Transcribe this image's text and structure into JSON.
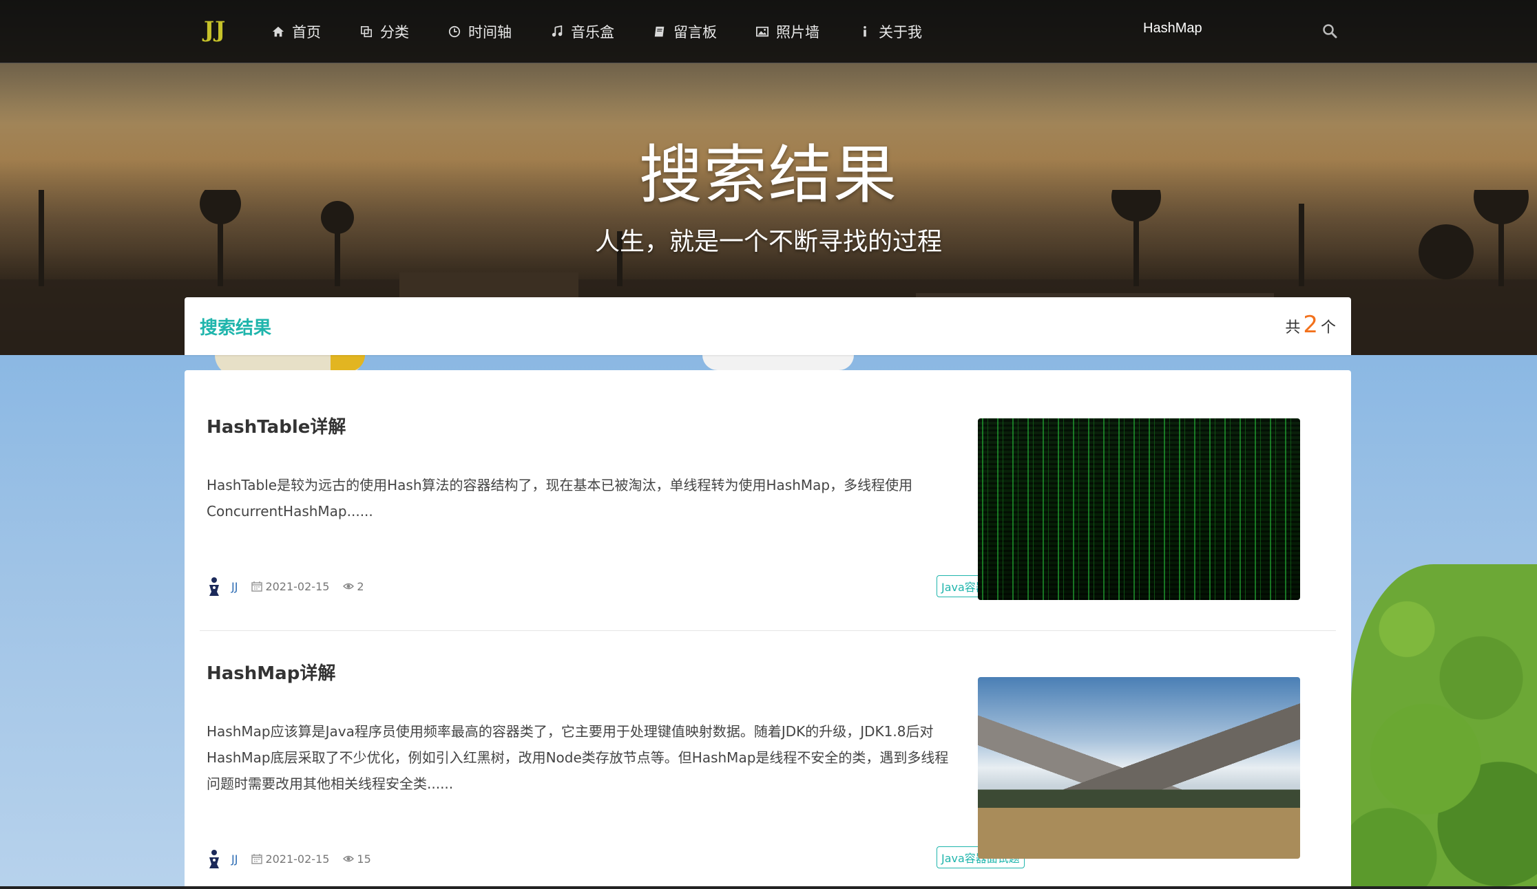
{
  "navbar": {
    "brand": "JJ",
    "items": [
      {
        "label": "首页",
        "icon": "home-icon"
      },
      {
        "label": "分类",
        "icon": "copy-icon"
      },
      {
        "label": "时间轴",
        "icon": "clock-icon"
      },
      {
        "label": "音乐盒",
        "icon": "music-icon"
      },
      {
        "label": "留言板",
        "icon": "book-icon"
      },
      {
        "label": "照片墙",
        "icon": "image-icon"
      },
      {
        "label": "关于我",
        "icon": "info-icon"
      }
    ],
    "search_value": "HashMap"
  },
  "hero": {
    "title": "搜索结果",
    "subtitle": "人生，就是一个不断寻找的过程"
  },
  "results_header": {
    "title": "搜索结果",
    "count_prefix": "共",
    "count": "2",
    "count_suffix": "个"
  },
  "results": [
    {
      "title": "HashTable详解",
      "description": "HashTable是较为远古的使用Hash算法的容器结构了，现在基本已被淘汰，单线程转为使用HashMap，多线程使用ConcurrentHashMap......",
      "author": "JJ",
      "date": "2021-02-15",
      "views": "2",
      "tag": "Java容器面试题",
      "image": "matrix-code-image"
    },
    {
      "title": "HashMap详解",
      "description": "HashMap应该算是Java程序员使用频率最高的容器类了，它主要用于处理键值映射数据。随着JDK的升级，JDK1.8后对HashMap底层采取了不少优化，例如引入红黑树，改用Node类存放节点等。但HashMap是线程不安全的类，遇到多线程问题时需要改用其他相关线程安全类......",
      "author": "JJ",
      "date": "2021-02-15",
      "views": "15",
      "tag": "Java容器面试题",
      "image": "mountain-landscape-image"
    }
  ],
  "colors": {
    "accent": "#1fb5ac",
    "count": "#f2711c",
    "brand": "#c6c22a",
    "author": "#2b6bb3"
  }
}
